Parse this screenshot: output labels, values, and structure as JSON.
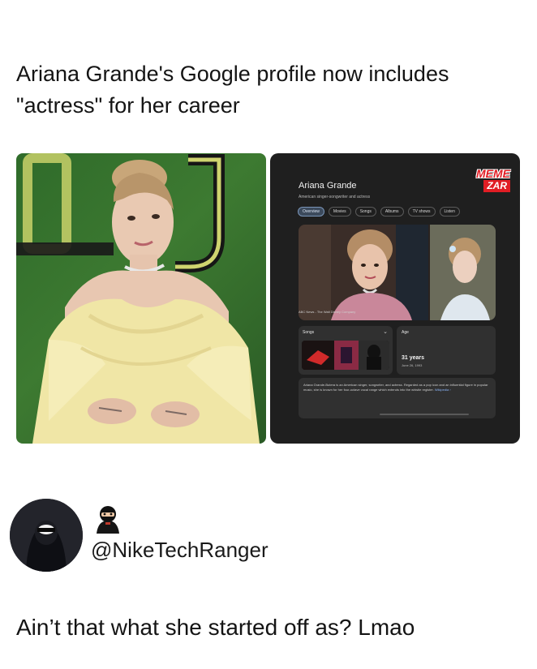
{
  "post": {
    "headline": "Ariana Grande's Google profile now includes \"actress\" for her career",
    "caption": "Ain’t that what she started off as? Lmao"
  },
  "author": {
    "handle": "@NikeTechRanger",
    "avatar_icon": "hooded-figure-avatar",
    "badge_icon": "ninja-emoji-icon"
  },
  "google_panel": {
    "watermark_top": "MEME",
    "watermark_bottom": "ZAR",
    "name": "Ariana Grande",
    "subtitle": "American singer-songwriter and actress",
    "tabs": [
      {
        "label": "Overview",
        "active": true
      },
      {
        "label": "Movies",
        "active": false
      },
      {
        "label": "Songs",
        "active": false
      },
      {
        "label": "Albums",
        "active": false
      },
      {
        "label": "TV shows",
        "active": false
      },
      {
        "label": "Listen",
        "active": false
      }
    ],
    "image_caption": "ABC News - The Walt Disney Company",
    "songs_card": {
      "title": "Songs",
      "chevron_icon": "chevron-down-icon"
    },
    "age_card": {
      "label": "Age",
      "years": "31 years",
      "date": "June 26, 1993"
    },
    "bio": {
      "text": "Ariana Grande-Butera is an American singer, songwriter, and actress. Regarded as a pop icon and an influential figure in popular music, she is known for her four-octave vocal range which extends into the whistle register.",
      "link": "Wikipedia ›"
    }
  },
  "colors": {
    "panel_bg": "#1f1f1f",
    "card_bg": "#303030",
    "watermark_red": "#e11d24",
    "link_blue": "#8ab4f8",
    "photo_green": "#2f6b2a"
  }
}
